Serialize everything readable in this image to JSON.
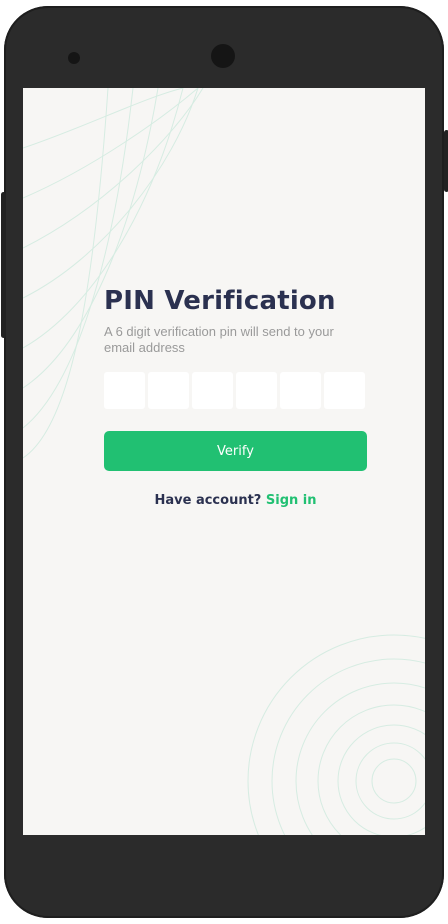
{
  "screen": {
    "title": "PIN Verification",
    "subtitle": "A 6 digit verification pin will send to your email address",
    "pin_boxes": [
      "",
      "",
      "",
      "",
      "",
      ""
    ],
    "verify_label": "Verify",
    "have_account_text": "Have account?",
    "signin_label": "Sign in"
  },
  "colors": {
    "accent": "#21c072",
    "title": "#2b3150",
    "background": "#f7f6f4",
    "device": "#2b2b2b"
  },
  "icons": [
    "speaker-icon",
    "front-camera-icon"
  ]
}
